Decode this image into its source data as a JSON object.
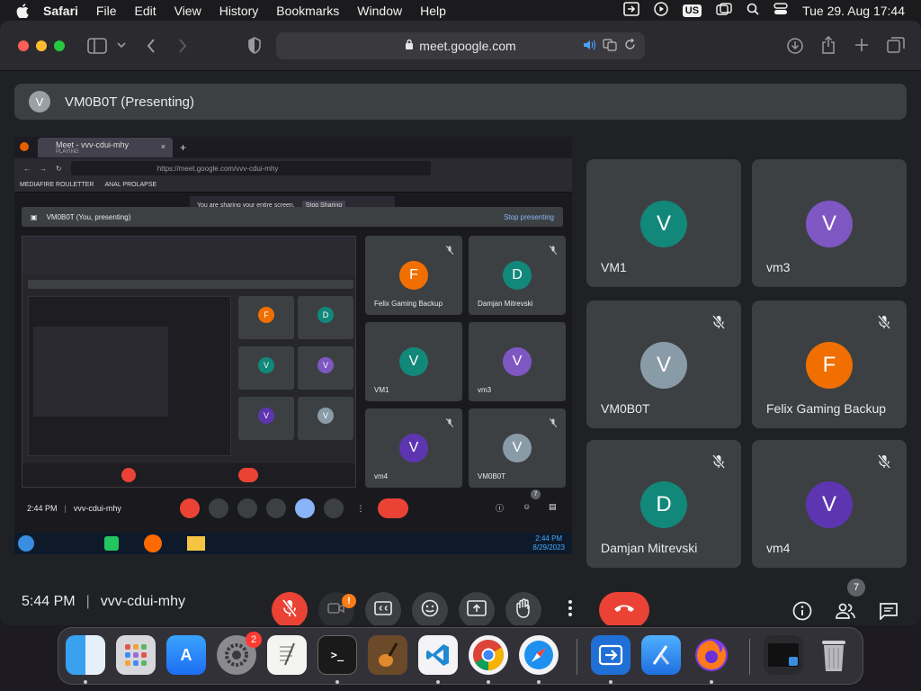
{
  "menubar": {
    "app": "Safari",
    "items": [
      "File",
      "Edit",
      "View",
      "History",
      "Bookmarks",
      "Window",
      "Help"
    ],
    "input_source": "US",
    "datetime": "Tue 29. Aug  17:44"
  },
  "browser": {
    "url": "meet.google.com"
  },
  "meet": {
    "presenter_initial": "V",
    "presenter_title": "VM0B0T (Presenting)",
    "meeting_time": "5:44 PM",
    "meeting_code": "vvv-cdui-mhy",
    "camera_badge": "!",
    "participant_count": "7",
    "tiles": [
      {
        "initial": "V",
        "name": "VM1",
        "color": "#12887a",
        "muted": false
      },
      {
        "initial": "V",
        "name": "vm3",
        "color": "#7e57c2",
        "muted": false
      },
      {
        "initial": "V",
        "name": "VM0B0T",
        "color": "#8a9ba8",
        "muted": true
      },
      {
        "initial": "F",
        "name": "Felix Gaming Backup",
        "color": "#f06f00",
        "muted": true
      },
      {
        "initial": "D",
        "name": "Damjan Mitrevski",
        "color": "#12887a",
        "muted": true
      },
      {
        "initial": "V",
        "name": "vm4",
        "color": "#5e35b1",
        "muted": true
      }
    ]
  },
  "shared_screen": {
    "tab_title": "Meet - vvv-cdui-mhy",
    "tab_subtitle": "PLAYING",
    "url": "https://meet.google.com/vvv-cdui-mhy",
    "bookmarks": [
      "MEDIAFIRE ROULETTER",
      "ANAL PROLAPSE"
    ],
    "share_notice": "You are sharing your entire screen.",
    "stop_sharing": "Stop Sharing",
    "presenting_label": "VM0B0T (You, presenting)",
    "stop_presenting": "Stop presenting",
    "tiles": [
      {
        "initial": "F",
        "name": "Felix Gaming Backup",
        "color": "#f06f00"
      },
      {
        "initial": "D",
        "name": "Damjan Mitrevski",
        "color": "#12887a"
      },
      {
        "initial": "V",
        "name": "VM1",
        "color": "#12887a"
      },
      {
        "initial": "V",
        "name": "vm3",
        "color": "#7e57c2"
      },
      {
        "initial": "V",
        "name": "vm4",
        "color": "#5e35b1"
      },
      {
        "initial": "V",
        "name": "VM0B0T",
        "color": "#8a9ba8"
      }
    ],
    "time": "2:44 PM",
    "code": "vvv-cdui-mhy",
    "people_count": "7",
    "clock_time": "2:44 PM",
    "clock_date": "8/29/2023"
  },
  "dock": {
    "settings_badge": "2"
  }
}
